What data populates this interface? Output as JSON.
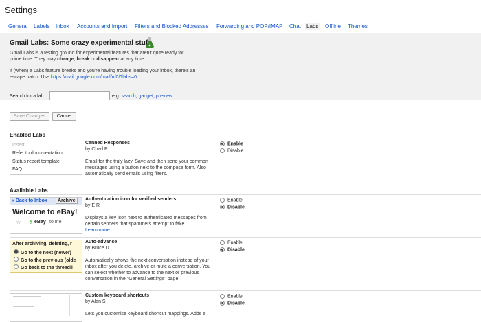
{
  "header": {
    "title": "Settings"
  },
  "tabs": [
    {
      "label": "General",
      "active": false
    },
    {
      "label": "Labels",
      "active": false
    },
    {
      "label": "Inbox",
      "active": false
    },
    {
      "label": "Accounts and Import",
      "active": false
    },
    {
      "label": "Filters and Blocked Addresses",
      "active": false
    },
    {
      "label": "Forwarding and POP/IMAP",
      "active": false
    },
    {
      "label": "Chat",
      "active": false
    },
    {
      "label": "Labs",
      "active": true
    },
    {
      "label": "Offline",
      "active": false
    },
    {
      "label": "Themes",
      "active": false
    }
  ],
  "intro": {
    "heading": "Gmail Labs: Some crazy experimental stuff.",
    "p1_a": "Gmail Labs is a testing ground for experimental features that aren't quite ready for",
    "p1_b": "prime time. They may ",
    "p1_change": "change",
    "p1_c": ", ",
    "p1_break": "break",
    "p1_d": " or ",
    "p1_disappear": "disappear",
    "p1_e": " at any time.",
    "p2_a": "If (when) a Labs feature breaks and you're having trouble loading your inbox, there's an",
    "p2_b": "escape hatch. Use ",
    "p2_link": "https://mail.google.com/mail/u/0/?labs=0",
    "p2_c": "."
  },
  "search": {
    "label": "Search for a lab:",
    "value": "",
    "eg": "e.g.",
    "ex1": "search",
    "ex2": "gadget",
    "ex3": "preview",
    "sep": ","
  },
  "buttons": {
    "save": "Save Changes",
    "cancel": "Cancel"
  },
  "enabled_title": "Enabled Labs",
  "available_title": "Available Labs",
  "canned_preview": {
    "items": [
      "Insert",
      "Refer to documentation",
      "Status report template",
      "FAQ"
    ]
  },
  "ebay_preview": {
    "back": "« Back to Inbox",
    "archive": "Archive",
    "welcome": "Welcome to eBay!",
    "from": "eBay",
    "to": "to me"
  },
  "adv_preview": {
    "line1": "After archiving, deleting, r",
    "opt1": "Go to the next (newer)",
    "opt2": "Go to the previous (olde",
    "opt3": "Go back to the threadli"
  },
  "labs": [
    {
      "title": "Canned Responses",
      "by": "by Chad P",
      "desc": "Email for the truly lazy. Save and then send your common messages using a button next to the compose form. Also automatically send emails using filters.",
      "enable": "Enable",
      "disable": "Disable",
      "selected": "enable",
      "link": ""
    },
    {
      "title": "Authentication icon for verified senders",
      "by": "by E R",
      "desc": "Displays a key icon next to authenticated messages from certain senders that spammers attempt to fake.",
      "enable": "Enable",
      "disable": "Disable",
      "selected": "disable",
      "link": "Learn more"
    },
    {
      "title": "Auto-advance",
      "by": "by Bruce D",
      "desc": "Automatically shows the next conversation instead of your inbox after you delete, archive or mute a conversation. You can select whether to advance to the next or previous conversation in the \"General Settings\" page.",
      "enable": "Enable",
      "disable": "Disable",
      "selected": "disable",
      "link": ""
    },
    {
      "title": "Custom keyboard shortcuts",
      "by": "by Alan S",
      "desc": "Lets you customise keyboard shortcut mappings. Adds a",
      "enable": "Enable",
      "disable": "Disable",
      "selected": "disable",
      "link": ""
    }
  ]
}
